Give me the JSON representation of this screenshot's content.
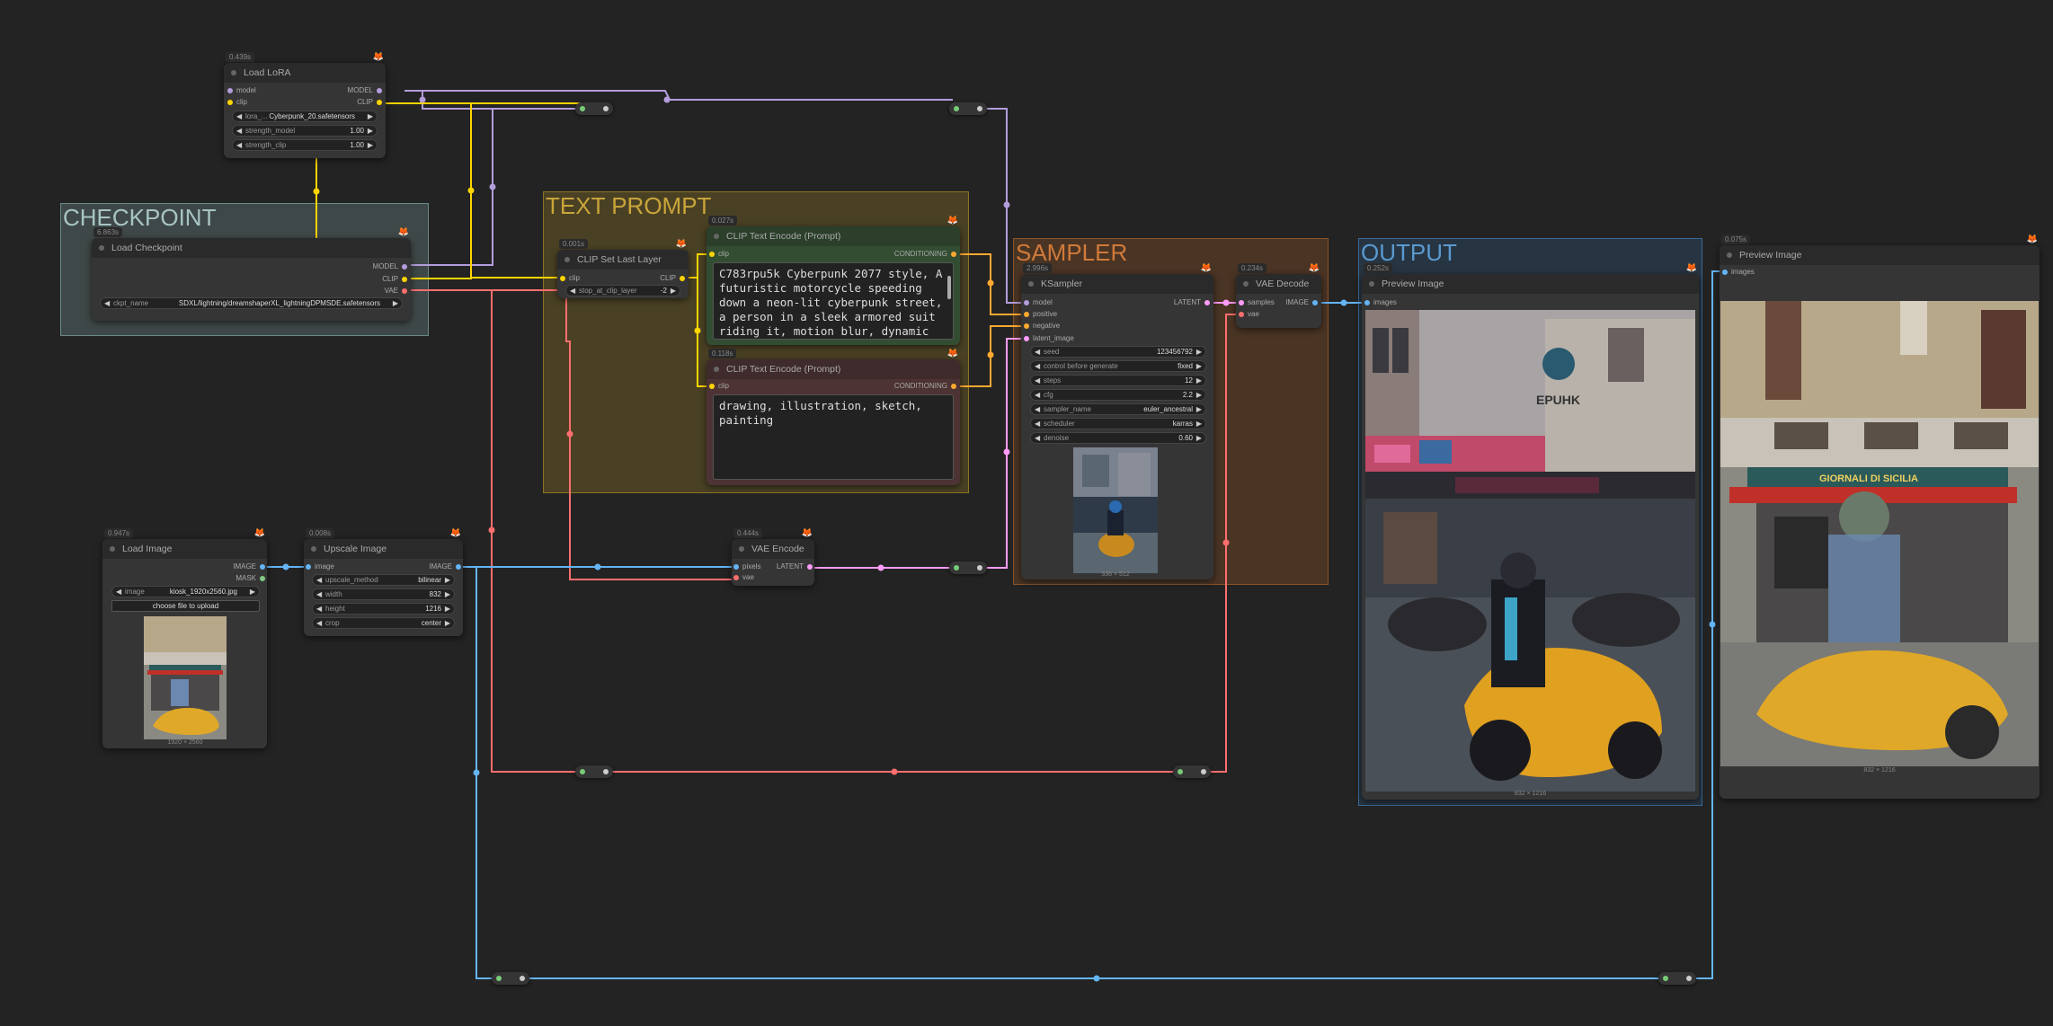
{
  "groups": {
    "checkpoint": {
      "title": "CHECKPOINT"
    },
    "text_prompt": {
      "title": "TEXT PROMPT"
    },
    "sampler": {
      "title": "SAMPLER"
    },
    "output": {
      "title": "OUTPUT"
    }
  },
  "nodes": {
    "load_lora": {
      "timing": "0.439s",
      "title": "Load LoRA",
      "inputs": [
        "model",
        "clip"
      ],
      "outputs": [
        "MODEL",
        "CLIP"
      ],
      "widgets": [
        {
          "label": "lora_...",
          "value": "Cyberpunk_20.safetensors"
        },
        {
          "label": "strength_model",
          "value": "1.00"
        },
        {
          "label": "strength_clip",
          "value": "1.00"
        }
      ]
    },
    "load_checkpoint": {
      "timing": "6.863s",
      "title": "Load Checkpoint",
      "outputs": [
        "MODEL",
        "CLIP",
        "VAE"
      ],
      "widgets": [
        {
          "label": "ckpt_name",
          "value": "SDXL/lightning/dreamshaperXL_lightningDPMSDE.safetensors"
        }
      ]
    },
    "clip_set_last_layer": {
      "timing": "0.001s",
      "title": "CLIP Set Last Layer",
      "inputs": [
        "clip"
      ],
      "outputs": [
        "CLIP"
      ],
      "widgets": [
        {
          "label": "stop_at_clip_layer",
          "value": "-2"
        }
      ]
    },
    "clip_positive": {
      "timing": "0.027s",
      "title": "CLIP Text Encode (Prompt)",
      "inputs": [
        "clip"
      ],
      "outputs": [
        "CONDITIONING"
      ],
      "text": "C783rpu5k Cyberpunk 2077 style, A futuristic motorcycle speeding down a neon-lit cyberpunk street, a person in a sleek armored suit riding it, motion blur, dynamic"
    },
    "clip_negative": {
      "timing": "0.118s",
      "title": "CLIP Text Encode (Prompt)",
      "inputs": [
        "clip"
      ],
      "outputs": [
        "CONDITIONING"
      ],
      "text": "drawing, illustration, sketch, painting"
    },
    "ksampler": {
      "timing": "2.996s",
      "title": "KSampler",
      "inputs": [
        "model",
        "positive",
        "negative",
        "latent_image"
      ],
      "outputs": [
        "LATENT"
      ],
      "widgets": [
        {
          "label": "seed",
          "value": "123456792"
        },
        {
          "label": "control before generate",
          "value": "fixed"
        },
        {
          "label": "steps",
          "value": "12"
        },
        {
          "label": "cfg",
          "value": "2.2"
        },
        {
          "label": "sampler_name",
          "value": "euler_ancestral"
        },
        {
          "label": "scheduler",
          "value": "karras"
        },
        {
          "label": "denoise",
          "value": "0.60"
        }
      ],
      "caption": "336 × 512"
    },
    "vae_decode": {
      "timing": "0.234s",
      "title": "VAE Decode",
      "inputs": [
        "samples",
        "vae"
      ],
      "outputs": [
        "IMAGE"
      ]
    },
    "preview_1": {
      "timing": "0.252s",
      "title": "Preview Image",
      "inputs": [
        "images"
      ],
      "caption": "832 × 1216"
    },
    "preview_2": {
      "timing": "0.075s",
      "title": "Preview Image",
      "inputs": [
        "images"
      ],
      "caption": "832 × 1216"
    },
    "load_image": {
      "timing": "0.947s",
      "title": "Load Image",
      "outputs": [
        "IMAGE",
        "MASK"
      ],
      "widgets": [
        {
          "label": "image",
          "value": "kiosk_1920x2560.jpg"
        }
      ],
      "upload_label": "choose file to upload",
      "caption": "1920 × 2560"
    },
    "upscale_image": {
      "timing": "0.008s",
      "title": "Upscale Image",
      "inputs": [
        "image"
      ],
      "outputs": [
        "IMAGE"
      ],
      "widgets": [
        {
          "label": "upscale_method",
          "value": "bilinear"
        },
        {
          "label": "width",
          "value": "832"
        },
        {
          "label": "height",
          "value": "1216"
        },
        {
          "label": "crop",
          "value": "center"
        }
      ]
    },
    "vae_encode": {
      "timing": "0.444s",
      "title": "VAE Encode",
      "inputs": [
        "pixels",
        "vae"
      ],
      "outputs": [
        "LATENT"
      ]
    }
  },
  "colors": {
    "model": "#b39ddb",
    "clip": "#ffd500",
    "vae": "#ff6e6e",
    "conditioning": "#ffa931",
    "latent": "#ff9cf9",
    "image": "#64b5f6",
    "mask": "#81c784"
  }
}
